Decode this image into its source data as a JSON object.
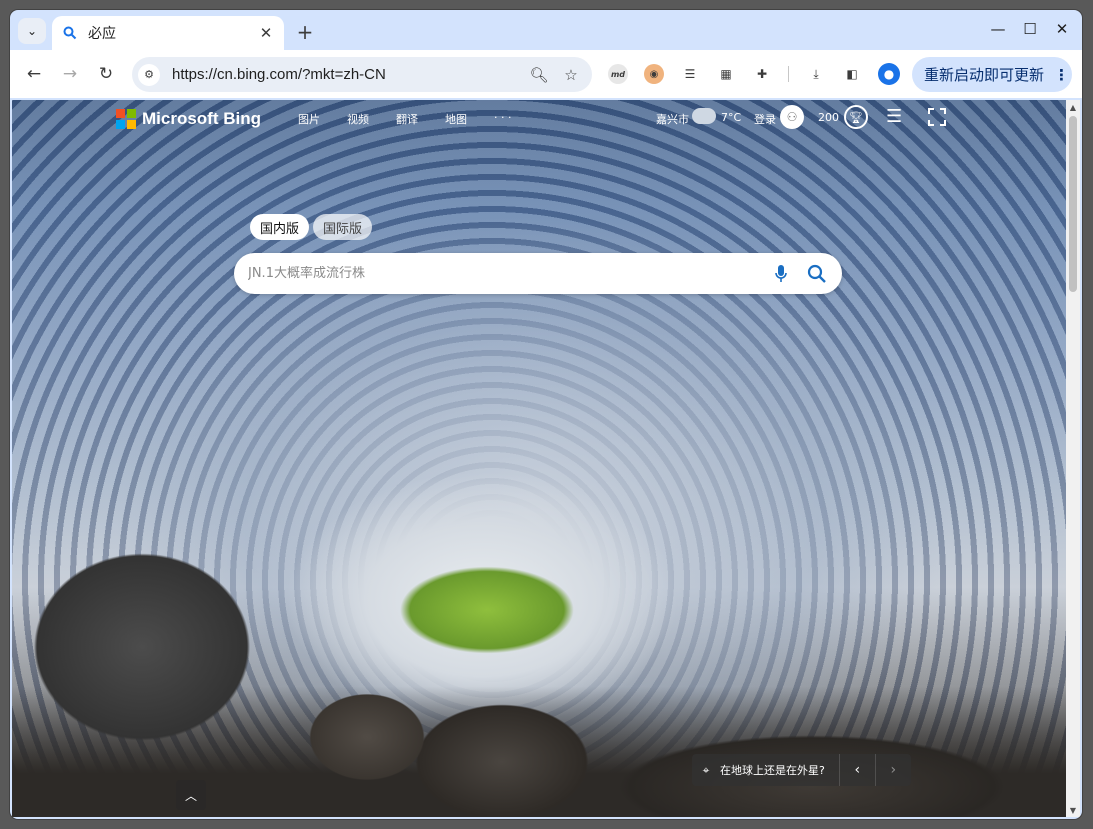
{
  "browser": {
    "tab": {
      "title": "必应"
    },
    "url": "https://cn.bing.com/?mkt=zh-CN",
    "update_button_label": "重新启动即可更新",
    "icons": {
      "tab_search": "chevron-down-icon",
      "new_tab": "plus-icon",
      "back": "arrow-left-icon",
      "forward": "arrow-right-icon",
      "reload": "reload-icon"
    }
  },
  "bing": {
    "brand": "Microsoft Bing",
    "nav": [
      "图片",
      "视频",
      "翻译",
      "地图",
      "· · ·"
    ],
    "weather": {
      "city": "嘉兴市",
      "temp": "7°C"
    },
    "login_label": "登录",
    "rewards_points": "200",
    "region_tabs": {
      "active": "国内版",
      "inactive": "国际版"
    },
    "search_placeholder": "JN.1大概率成流行株",
    "image_caption": "在地球上还是在外星?"
  },
  "colors": {
    "accent": "#1a73e8",
    "chrome_frame": "#d3e3fd",
    "search_icon": "#1a6ec2"
  }
}
